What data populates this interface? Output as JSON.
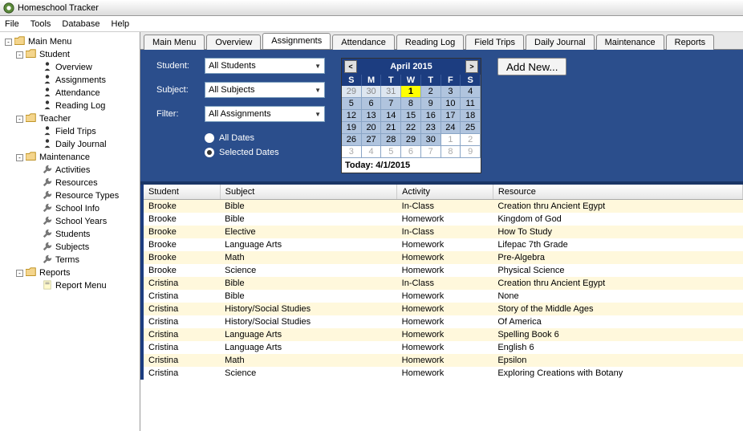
{
  "app": {
    "title": "Homeschool Tracker"
  },
  "menubar": [
    "File",
    "Tools",
    "Database",
    "Help"
  ],
  "tree": [
    {
      "depth": 0,
      "exp": "-",
      "icon": "folder",
      "label": "Main Menu"
    },
    {
      "depth": 1,
      "exp": "-",
      "icon": "folder",
      "label": "Student"
    },
    {
      "depth": 2,
      "exp": "",
      "icon": "person",
      "label": "Overview"
    },
    {
      "depth": 2,
      "exp": "",
      "icon": "person",
      "label": "Assignments"
    },
    {
      "depth": 2,
      "exp": "",
      "icon": "person",
      "label": "Attendance"
    },
    {
      "depth": 2,
      "exp": "",
      "icon": "person",
      "label": "Reading Log"
    },
    {
      "depth": 1,
      "exp": "-",
      "icon": "folder",
      "label": "Teacher"
    },
    {
      "depth": 2,
      "exp": "",
      "icon": "person",
      "label": "Field Trips"
    },
    {
      "depth": 2,
      "exp": "",
      "icon": "person",
      "label": "Daily Journal"
    },
    {
      "depth": 1,
      "exp": "-",
      "icon": "folder",
      "label": "Maintenance"
    },
    {
      "depth": 2,
      "exp": "",
      "icon": "wrench",
      "label": "Activities"
    },
    {
      "depth": 2,
      "exp": "",
      "icon": "wrench",
      "label": "Resources"
    },
    {
      "depth": 2,
      "exp": "",
      "icon": "wrench",
      "label": "Resource Types"
    },
    {
      "depth": 2,
      "exp": "",
      "icon": "wrench",
      "label": "School Info"
    },
    {
      "depth": 2,
      "exp": "",
      "icon": "wrench",
      "label": "School Years"
    },
    {
      "depth": 2,
      "exp": "",
      "icon": "wrench",
      "label": "Students"
    },
    {
      "depth": 2,
      "exp": "",
      "icon": "wrench",
      "label": "Subjects"
    },
    {
      "depth": 2,
      "exp": "",
      "icon": "wrench",
      "label": "Terms"
    },
    {
      "depth": 1,
      "exp": "-",
      "icon": "folder",
      "label": "Reports"
    },
    {
      "depth": 2,
      "exp": "",
      "icon": "report",
      "label": "Report Menu"
    }
  ],
  "tabs": {
    "items": [
      "Main Menu",
      "Overview",
      "Assignments",
      "Attendance",
      "Reading Log",
      "Field Trips",
      "Daily Journal",
      "Maintenance",
      "Reports"
    ],
    "active": "Assignments"
  },
  "filters": {
    "student_label": "Student:",
    "student_value": "All Students",
    "subject_label": "Subject:",
    "subject_value": "All Subjects",
    "filter_label": "Filter:",
    "filter_value": "All Assignments",
    "radio_all": "All Dates",
    "radio_selected": "Selected Dates",
    "radio_choice": "selected"
  },
  "calendar": {
    "title": "April 2015",
    "dow": [
      "S",
      "M",
      "T",
      "W",
      "T",
      "F",
      "S"
    ],
    "prev_dim": [
      "29",
      "30",
      "31"
    ],
    "days": [
      "1",
      "2",
      "3",
      "4",
      "5",
      "6",
      "7",
      "8",
      "9",
      "10",
      "11",
      "12",
      "13",
      "14",
      "15",
      "16",
      "17",
      "18",
      "19",
      "20",
      "21",
      "22",
      "23",
      "24",
      "25",
      "26",
      "27",
      "28",
      "29",
      "30"
    ],
    "trail": [
      "1",
      "2",
      "3",
      "4",
      "5",
      "6",
      "7",
      "8",
      "9"
    ],
    "today": "1",
    "footer": "Today: 4/1/2015"
  },
  "add_button": "Add New...",
  "grid": {
    "columns": [
      "Student",
      "Subject",
      "Activity",
      "Resource"
    ],
    "rows": [
      [
        "Brooke",
        "Bible",
        "In-Class",
        "Creation thru Ancient Egypt"
      ],
      [
        "Brooke",
        "Bible",
        "Homework",
        "Kingdom of God"
      ],
      [
        "Brooke",
        "Elective",
        "In-Class",
        "How To Study"
      ],
      [
        "Brooke",
        "Language Arts",
        "Homework",
        "Lifepac 7th Grade"
      ],
      [
        "Brooke",
        "Math",
        "Homework",
        "Pre-Algebra"
      ],
      [
        "Brooke",
        "Science",
        "Homework",
        "Physical Science"
      ],
      [
        "Cristina",
        "Bible",
        "In-Class",
        "Creation thru Ancient Egypt"
      ],
      [
        "Cristina",
        "Bible",
        "Homework",
        "None"
      ],
      [
        "Cristina",
        "History/Social Studies",
        "Homework",
        "Story of the Middle Ages"
      ],
      [
        "Cristina",
        "History/Social Studies",
        "Homework",
        "Of America"
      ],
      [
        "Cristina",
        "Language Arts",
        "Homework",
        "Spelling Book 6"
      ],
      [
        "Cristina",
        "Language Arts",
        "Homework",
        "English 6"
      ],
      [
        "Cristina",
        "Math",
        "Homework",
        "Epsilon"
      ],
      [
        "Cristina",
        "Science",
        "Homework",
        "Exploring Creations with Botany"
      ]
    ]
  }
}
